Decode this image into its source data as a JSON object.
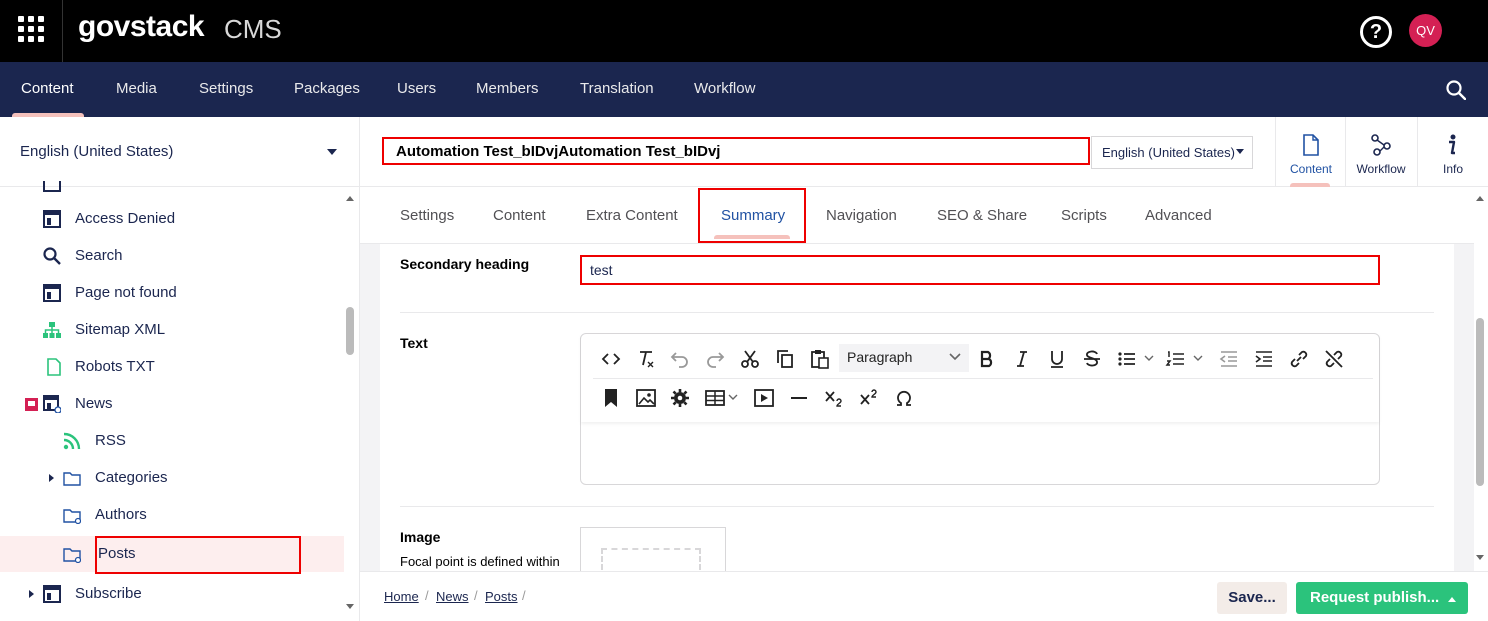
{
  "header": {
    "brand": "govstack",
    "brand_sub": "CMS",
    "help": "?",
    "avatar_initials": "QV"
  },
  "sections": [
    "Content",
    "Media",
    "Settings",
    "Packages",
    "Users",
    "Members",
    "Translation",
    "Workflow"
  ],
  "tree": {
    "culture": "English (United States)",
    "items": [
      {
        "label": "Access Denied",
        "icon": "page-icon"
      },
      {
        "label": "Search",
        "icon": "search-icon"
      },
      {
        "label": "Page not found",
        "icon": "page-icon"
      },
      {
        "label": "Sitemap XML",
        "icon": "sitemap-icon"
      },
      {
        "label": "Robots TXT",
        "icon": "document-icon"
      },
      {
        "label": "News",
        "icon": "news-icon"
      },
      {
        "label": "RSS",
        "icon": "rss-icon"
      },
      {
        "label": "Categories",
        "icon": "folder-icon"
      },
      {
        "label": "Authors",
        "icon": "folder-icon"
      },
      {
        "label": "Posts",
        "icon": "folder-icon"
      },
      {
        "label": "Subscribe",
        "icon": "page-icon"
      }
    ]
  },
  "editor": {
    "name_value": "Automation Test_bIDvjAutomation Test_bIDvj",
    "language": "English (United States)",
    "apps": [
      "Content",
      "Workflow",
      "Info"
    ],
    "tabs": [
      "Settings",
      "Content",
      "Extra Content",
      "Summary",
      "Navigation",
      "SEO & Share",
      "Scripts",
      "Advanced"
    ]
  },
  "properties": {
    "secondary_heading_label": "Secondary heading",
    "secondary_heading_value": "test",
    "text_label": "Text",
    "format_select": "Paragraph",
    "image_label": "Image",
    "image_desc": "Focal point is defined within"
  },
  "breadcrumb": [
    "Home",
    "News",
    "Posts"
  ],
  "buttons": {
    "save": "Save...",
    "publish": "Request publish..."
  },
  "colors": {
    "topbar": "#000000",
    "navbar": "#1b264f",
    "accent": "#2152a3",
    "publish": "#2bc37c",
    "avatar": "#d42054",
    "highlight": "#ee0000"
  }
}
